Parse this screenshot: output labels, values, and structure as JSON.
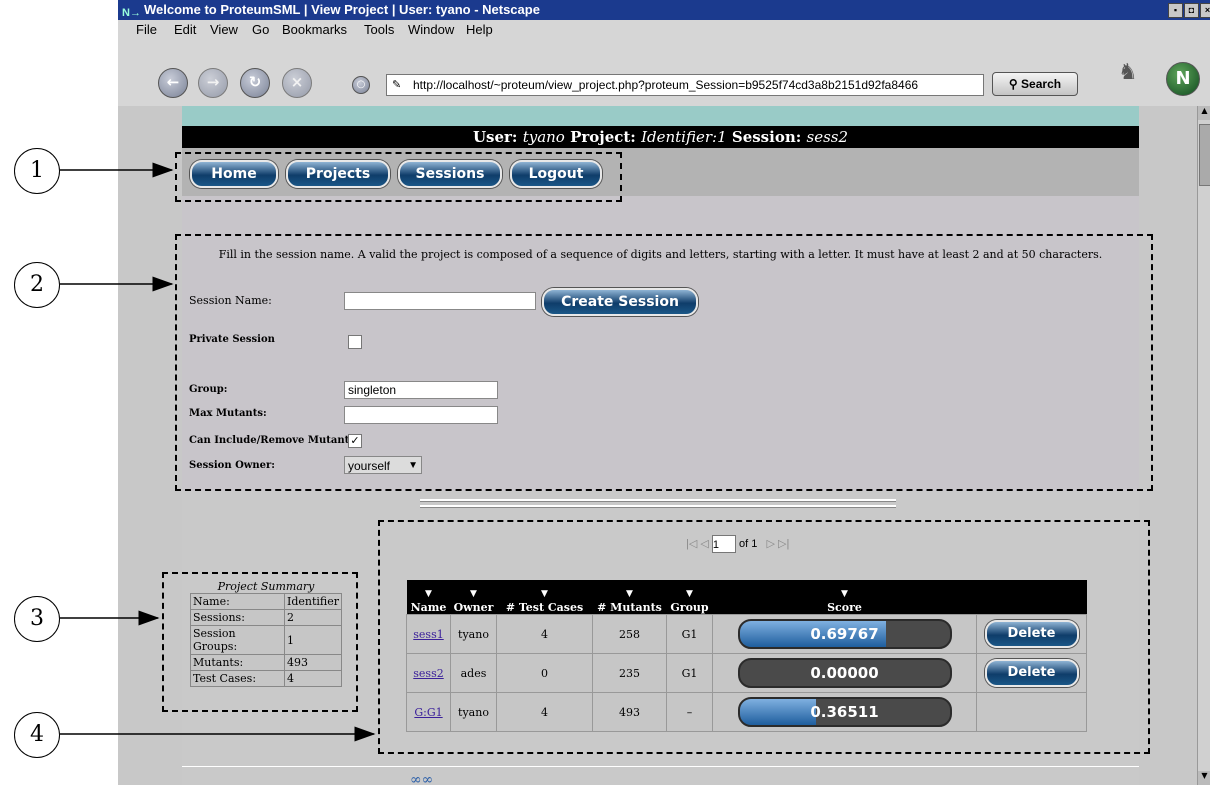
{
  "window": {
    "title": "Welcome to ProteumSML | View Project | User: tyano - Netscape"
  },
  "menu": {
    "items": [
      "File",
      "Edit",
      "View",
      "Go",
      "Bookmarks",
      "Tools",
      "Window",
      "Help"
    ]
  },
  "browser": {
    "url": "http://localhost/~proteum/view_project.php?proteum_Session=b9525f74cd3a8b2151d92fa8466",
    "search_label": "Search"
  },
  "header": {
    "user_label": "User:",
    "user": "tyano",
    "project_label": "Project:",
    "project": "Identifier:1",
    "session_label": "Session:",
    "session": "sess2"
  },
  "nav": {
    "home": "Home",
    "projects": "Projects",
    "sessions": "Sessions",
    "logout": "Logout"
  },
  "form": {
    "instructions": "Fill in the session name. A valid the project is composed of a sequence of digits and letters, starting with a letter. It must have at least 2 and at 50 characters.",
    "session_name_label": "Session Name:",
    "session_name_value": "",
    "create_button": "Create Session",
    "private_label": "Private Session",
    "private_checked": false,
    "group_label": "Group:",
    "group_value": "singleton",
    "max_mutants_label": "Max Mutants:",
    "max_mutants_value": "",
    "can_include_label": "Can Include/Remove Mutants:",
    "can_include_checked": true,
    "check_mark": "✓",
    "owner_label": "Session Owner:",
    "owner_value": "yourself"
  },
  "summary": {
    "caption": "Project Summary",
    "rows": [
      {
        "label": "Name:",
        "value": "Identifier"
      },
      {
        "label": "Sessions:",
        "value": "2"
      },
      {
        "label": "Session Groups:",
        "value": "1"
      },
      {
        "label": "Mutants:",
        "value": "493"
      },
      {
        "label": "Test Cases:",
        "value": "4"
      }
    ]
  },
  "pager": {
    "page": "1",
    "of": "of 1"
  },
  "sessions_table": {
    "headers": [
      "Name",
      "Owner",
      "# Test Cases",
      "# Mutants",
      "Group",
      "Score"
    ],
    "delete_label": "Delete",
    "rows": [
      {
        "name": "sess1",
        "owner": "tyano",
        "tests": "4",
        "mutants": "258",
        "group": "G1",
        "score": "0.69767",
        "score_fraction": 0.69767,
        "deletable": true
      },
      {
        "name": "sess2",
        "owner": "ades",
        "tests": "0",
        "mutants": "235",
        "group": "G1",
        "score": "0.00000",
        "score_fraction": 0.0,
        "deletable": true
      },
      {
        "name": "G:G1",
        "owner": "tyano",
        "tests": "4",
        "mutants": "493",
        "group": "–",
        "score": "0.36511",
        "score_fraction": 0.36511,
        "deletable": false
      }
    ]
  },
  "annotations": {
    "callouts": [
      "1",
      "2",
      "3",
      "4"
    ]
  }
}
